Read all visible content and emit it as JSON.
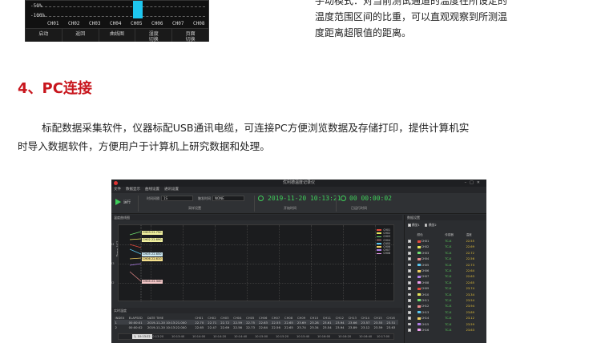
{
  "device": {
    "y_labels": [
      "-50%",
      "-100%"
    ],
    "channels": [
      "CH01",
      "CH02",
      "CH03",
      "CH04",
      "CH05",
      "CH06",
      "CH07",
      "CH08"
    ],
    "buttons": [
      "启动",
      "返回",
      "曲线图",
      "湿度\n切换",
      "页面\n切换"
    ],
    "bar_color": "#1ec6ef"
  },
  "side_text": {
    "line1": "手动模式：对当前测试通道的温度在所设定的",
    "line2": "温度范围区间的比重，可以直观观察到所测温",
    "line3": "度距离超限值的距离。"
  },
  "section": {
    "title": "4、PC连接",
    "title_color": "#c8161d"
  },
  "paragraph": {
    "line1": "标配数据采集软件，仪器标配USB通讯电缆，可连接PC方便浏览数据及存储打印，提供计算机实",
    "line2": "时导入数据软件，方便用户于计算机上研究数据和处理。"
  },
  "app": {
    "title": "优利德温度记录仪",
    "menu": [
      "文件",
      "数据显示",
      "曲线设置",
      "通讯设置"
    ],
    "run_label": "运行",
    "interval_label": "时间间隔",
    "interval_value": "1S",
    "trigger_label": "触发时间",
    "trigger_value": "NONE",
    "sample_settings": "采样设置",
    "start_time": "2019-11-20 10:13:21",
    "start_time_label": "开始时间",
    "elapsed": "00 00:00:02",
    "elapsed_label": "已运行时间",
    "curve_header": "温度曲线图",
    "y_axis_label": "Temp (℃)",
    "y_ticks": [
      "24",
      "23",
      "22"
    ],
    "x_ticks": [
      "10:13:00",
      "10:13:20",
      "10:13:40",
      "10:14:00",
      "10:14:20",
      "10:14:40",
      "10:15:00",
      "10:15:20",
      "10:15:40",
      "10:16:00",
      "10:16:20",
      "10:16:40",
      "10:17:00"
    ],
    "cursor_time": "1, 10:13:22",
    "curve_tags": [
      {
        "text": "CH03 22.750",
        "color": "#f2f2a0"
      },
      {
        "text": "CH02 22.690",
        "color": "#f2f2a0"
      },
      {
        "text": "CH05 22.650",
        "color": "#cdeaf5"
      },
      {
        "text": "CH06 22.610",
        "color": "#f5e08c"
      },
      {
        "text": "CH04 22.340",
        "color": "#f5c8c8"
      }
    ],
    "legend": [
      {
        "name": "CH01",
        "color": "#e64a3d"
      },
      {
        "name": "CH02",
        "color": "#e8e85a"
      },
      {
        "name": "CH03",
        "color": "#6fe06f"
      },
      {
        "name": "CH04",
        "color": "#e88a8a"
      },
      {
        "name": "CH05",
        "color": "#5ac8f0"
      },
      {
        "name": "CH06",
        "color": "#f0d060"
      },
      {
        "name": "CH07",
        "color": "#b07ee8"
      },
      {
        "name": "CH08",
        "color": "#f0a0f0"
      }
    ],
    "rt_header": "实时温度",
    "rt_columns": [
      "INDEX",
      "ELAPSED",
      "DATE TIME",
      "CH01",
      "CH02",
      "CH03",
      "CH04",
      "CH05",
      "CH06",
      "CH07",
      "CH08",
      "CH09",
      "CH10",
      "CH11",
      "CH12",
      "CH13",
      "CH14",
      "CH15",
      "CH16"
    ],
    "rt_rows": [
      [
        "1",
        "00:00:01",
        "2019-11-20 10:13:21.000",
        "22.70",
        "22.71",
        "22.72",
        "22.59",
        "22.75",
        "22.63",
        "22.55",
        "22.65",
        "23.69",
        "23.28",
        "23.61",
        "23.94",
        "23.66",
        "23.57",
        "23.55",
        "23.51"
      ],
      [
        "2",
        "00:00:02",
        "2019-11-20 10:13:22.000",
        "22.65",
        "22.47",
        "22.69",
        "22.56",
        "22.73",
        "22.64",
        "22.56",
        "22.65",
        "23.74",
        "23.34",
        "23.54",
        "23.94",
        "23.89",
        "23.12",
        "23.59",
        "23.63"
      ]
    ],
    "rp_header": "数据设置",
    "rp_check1": "横坐1",
    "rp_check2": "横坐2",
    "rp_columns": [
      "",
      "颜色",
      "传感器",
      "温度"
    ],
    "rp_rows": [
      {
        "ch": "CH01",
        "color": "#e64a3d",
        "sensor": "TC-K",
        "temp": "22.55"
      },
      {
        "ch": "CH02",
        "color": "#e8e85a",
        "sensor": "TC-K",
        "temp": "22.69"
      },
      {
        "ch": "CH03",
        "color": "#6fe06f",
        "sensor": "TC-K",
        "temp": "22.72"
      },
      {
        "ch": "CH04",
        "color": "#e88a8a",
        "sensor": "TC-K",
        "temp": "22.56"
      },
      {
        "ch": "CH05",
        "color": "#5ac8f0",
        "sensor": "TC-K",
        "temp": "22.73"
      },
      {
        "ch": "CH06",
        "color": "#f0d060",
        "sensor": "TC-K",
        "temp": "22.64"
      },
      {
        "ch": "CH07",
        "color": "#b07ee8",
        "sensor": "TC-K",
        "temp": "22.63"
      },
      {
        "ch": "CH08",
        "color": "#f0a0f0",
        "sensor": "TC-K",
        "temp": "22.65"
      },
      {
        "ch": "CH09",
        "color": "#e64a3d",
        "sensor": "TC-K",
        "temp": "23.74"
      },
      {
        "ch": "CH10",
        "color": "#e8e85a",
        "sensor": "TC-K",
        "temp": "23.34"
      },
      {
        "ch": "CH11",
        "color": "#6fe06f",
        "sensor": "TC-K",
        "temp": "23.54"
      },
      {
        "ch": "CH12",
        "color": "#e88a8a",
        "sensor": "TC-K",
        "temp": "23.94"
      },
      {
        "ch": "CH13",
        "color": "#5ac8f0",
        "sensor": "TC-K",
        "temp": "23.89"
      },
      {
        "ch": "CH14",
        "color": "#f0d060",
        "sensor": "TC-K",
        "temp": "23.12"
      },
      {
        "ch": "CH15",
        "color": "#b07ee8",
        "sensor": "TC-K",
        "temp": "23.59"
      },
      {
        "ch": "CH16",
        "color": "#f0a0f0",
        "sensor": "TC-K",
        "temp": "23.63"
      }
    ]
  }
}
